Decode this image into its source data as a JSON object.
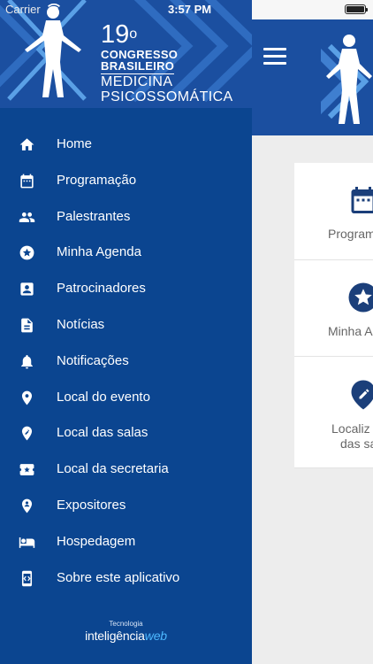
{
  "status_bar": {
    "carrier": "Carrier",
    "time": "3:57 PM"
  },
  "drawer": {
    "banner": {
      "number": "19",
      "sup": "o",
      "line1": "CONGRESSO",
      "line2": "BRASILEIRO",
      "line3": "MEDICINA",
      "line4": "PSICOSSOMÁTICA"
    },
    "menu": [
      {
        "label": "Home",
        "icon": "home-icon"
      },
      {
        "label": "Programação",
        "icon": "calendar-icon"
      },
      {
        "label": "Palestrantes",
        "icon": "people-icon"
      },
      {
        "label": "Minha Agenda",
        "icon": "star-circle-icon"
      },
      {
        "label": "Patrocinadores",
        "icon": "contact-badge-icon"
      },
      {
        "label": "Notícias",
        "icon": "document-icon"
      },
      {
        "label": "Notificações",
        "icon": "bell-icon"
      },
      {
        "label": "Local do evento",
        "icon": "map-pin-icon"
      },
      {
        "label": "Local das salas",
        "icon": "pin-edit-icon"
      },
      {
        "label": "Local da secretaria",
        "icon": "ticket-star-icon"
      },
      {
        "label": "Expositores",
        "icon": "pin-person-icon"
      },
      {
        "label": "Hospedagem",
        "icon": "hotel-bed-icon"
      },
      {
        "label": "Sobre este aplicativo",
        "icon": "device-code-icon"
      }
    ],
    "footer": {
      "caption": "Tecnologia",
      "brand_main": "inteligência",
      "brand_accent": "web"
    }
  },
  "main": {
    "cards": [
      {
        "label": "Programa",
        "icon": "calendar-icon"
      },
      {
        "label": "Minha Ag",
        "icon": "star-circle-icon"
      },
      {
        "label": "Localiz",
        "label2": "das sa",
        "icon": "pin-edit-icon"
      }
    ]
  },
  "colors": {
    "drawer_bg": "#0b4590",
    "banner_bg": "#1b4fa0",
    "accent_light": "#4db8ff",
    "icon_dark": "#1b3f7a",
    "main_bg": "#ededed"
  }
}
